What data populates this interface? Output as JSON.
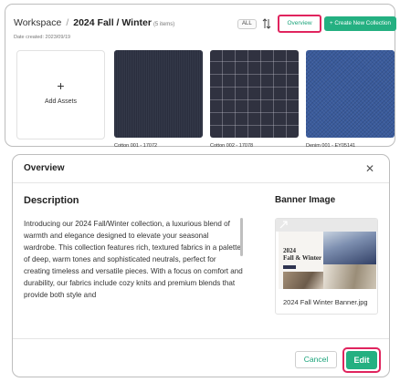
{
  "workspace": {
    "breadcrumb_root": "Workspace",
    "breadcrumb_separator": "/",
    "collection_name": "2024 Fall / Winter",
    "item_count": "(5 items)",
    "date_created": "Date created: 2023/09/19",
    "filter_chip": "ALL",
    "overview_label": "Overview",
    "create_label": "+ Create New Collection",
    "add_assets_plus": "+",
    "add_assets_label": "Add Assets",
    "tiles": [
      {
        "caption": "Cotton 001 - 17072",
        "pattern": "dark navy twill"
      },
      {
        "caption": "Cotton 002 - 17078",
        "pattern": "charcoal windowpane check"
      },
      {
        "caption": "Denim 001 - EY05141",
        "pattern": "blue denim"
      }
    ]
  },
  "modal": {
    "title": "Overview",
    "close_glyph": "✕",
    "description_heading": "Description",
    "description_text": "Introducing our 2024 Fall/Winter collection, a luxurious blend of warmth and elegance designed to elevate your seasonal wardrobe. This collection features rich, textured fabrics in a palette of deep, warm tones and sophisticated neutrals, perfect for creating timeless and versatile pieces. With a focus on comfort and durability, our fabrics include cozy knits and premium blends that provide both style and",
    "banner_heading": "Banner Image",
    "banner_image_title": "2024\nFall & Winter",
    "banner_file_name": "2024 Fall Winter Banner.jpg",
    "cancel_label": "Cancel",
    "edit_label": "Edit"
  },
  "colors": {
    "accent_green": "#24b081",
    "highlight_red": "#e0245e"
  },
  "icons": [
    "sort-icon",
    "close-icon",
    "expand-icon",
    "plus-icon"
  ]
}
